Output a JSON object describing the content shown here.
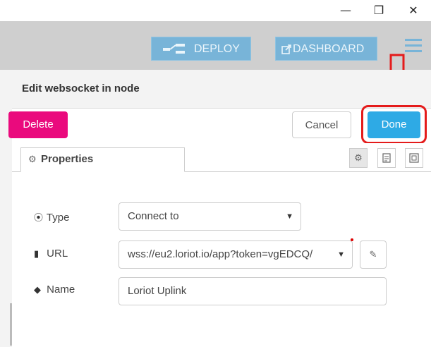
{
  "window": {
    "minimize": "—",
    "restore": "❐",
    "close": "✕"
  },
  "header": {
    "deploy_label": "DEPLOY",
    "dashboard_label": "DASHBOARD",
    "deploy_icon": "deploy-icon",
    "dashboard_icon": "external-link-icon",
    "accent": "#78b4d8"
  },
  "editor": {
    "title": "Edit websocket in node",
    "delete_label": "Delete",
    "cancel_label": "Cancel",
    "done_label": "Done",
    "tab_label": "Properties",
    "tab_icon": "gear-icon"
  },
  "form": {
    "type_label": "Type",
    "type_value": "Connect to",
    "url_label": "URL",
    "url_value": "wss://eu2.loriot.io/app?token=vgEDCQ/",
    "name_label": "Name",
    "name_value": "Loriot Uplink"
  },
  "colors": {
    "delete": "#ea0a7d",
    "done": "#2eaae5",
    "highlight": "#e41b1b"
  }
}
